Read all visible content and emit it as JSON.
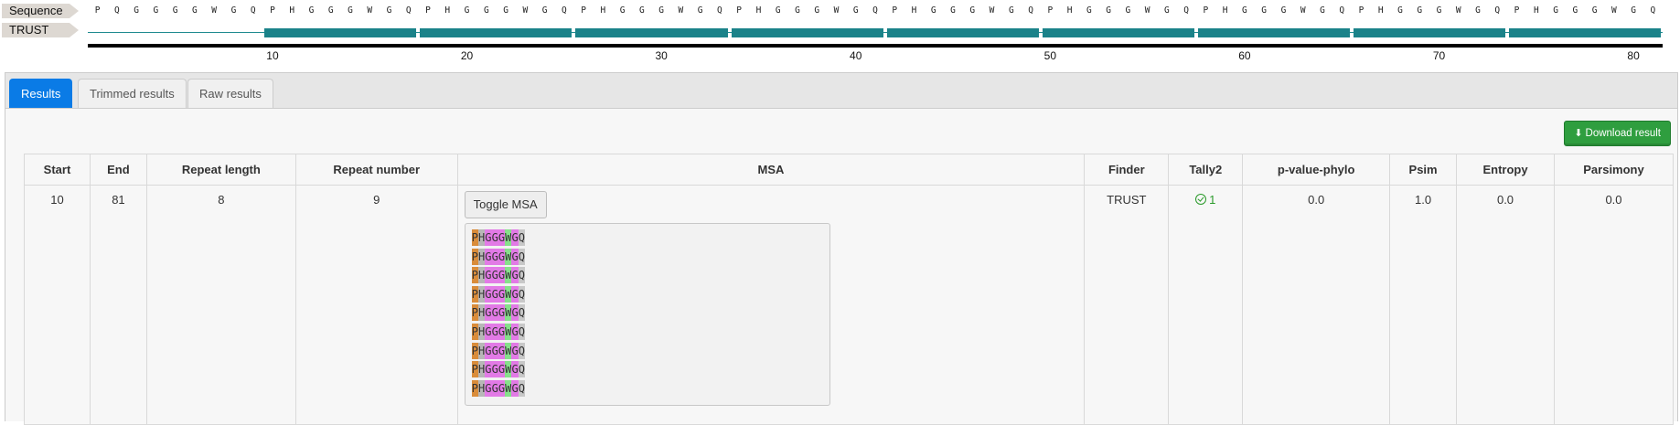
{
  "viewer": {
    "sequence_label": "Sequence",
    "track_label": "TRUST",
    "sequence": [
      "P",
      "Q",
      "G",
      "G",
      "G",
      "G",
      "W",
      "G",
      "Q",
      "P",
      "H",
      "G",
      "G",
      "G",
      "W",
      "G",
      "Q",
      "P",
      "H",
      "G",
      "G",
      "G",
      "W",
      "G",
      "Q",
      "P",
      "H",
      "G",
      "G",
      "G",
      "W",
      "G",
      "Q",
      "P",
      "H",
      "G",
      "G",
      "G",
      "W",
      "G",
      "Q",
      "P",
      "H",
      "G",
      "G",
      "G",
      "W",
      "G",
      "Q",
      "P",
      "H",
      "G",
      "G",
      "G",
      "W",
      "G",
      "Q",
      "P",
      "H",
      "G",
      "G",
      "G",
      "W",
      "G",
      "Q",
      "P",
      "H",
      "G",
      "G",
      "G",
      "W",
      "G",
      "Q",
      "P",
      "H",
      "G",
      "G",
      "G",
      "W",
      "G",
      "Q"
    ],
    "ticks": [
      "10",
      "20",
      "30",
      "40",
      "50",
      "60",
      "70",
      "80"
    ],
    "repeat_segments": [
      [
        10,
        17
      ],
      [
        18,
        25
      ],
      [
        26,
        33
      ],
      [
        34,
        41
      ],
      [
        42,
        49
      ],
      [
        50,
        57
      ],
      [
        58,
        65
      ],
      [
        66,
        73
      ],
      [
        74,
        81
      ]
    ],
    "segment_color": "#1a8289"
  },
  "tabs": [
    {
      "label": "Results",
      "active": true
    },
    {
      "label": "Trimmed results",
      "active": false
    },
    {
      "label": "Raw results",
      "active": false
    }
  ],
  "download_label": "Download result",
  "table": {
    "headers": [
      "Start",
      "End",
      "Repeat length",
      "Repeat number",
      "MSA",
      "Finder",
      "Tally2",
      "p-value-phylo",
      "Psim",
      "Entropy",
      "Parsimony"
    ],
    "row": {
      "start": "10",
      "end": "81",
      "repeat_length": "8",
      "repeat_number": "9",
      "toggle_label": "Toggle MSA",
      "finder": "TRUST",
      "tally2": "1",
      "p_value_phylo": "0.0",
      "psim": "1.0",
      "entropy": "0.0",
      "parsimony": "0.0"
    }
  },
  "msa": {
    "rows": [
      "PHGGGWGQ",
      "PHGGGWGQ",
      "PHGGGWGQ",
      "PHGGGWGQ",
      "PHGGGWGQ",
      "PHGGGWGQ",
      "PHGGGWGQ",
      "PHGGGWGQ",
      "PHGGGWGQ"
    ],
    "colors": {
      "P": "#d98c3a",
      "H": "#b7b7b7",
      "G": "#e27ae6",
      "W": "#86e08a",
      "Q": "#c8c8c8"
    }
  }
}
